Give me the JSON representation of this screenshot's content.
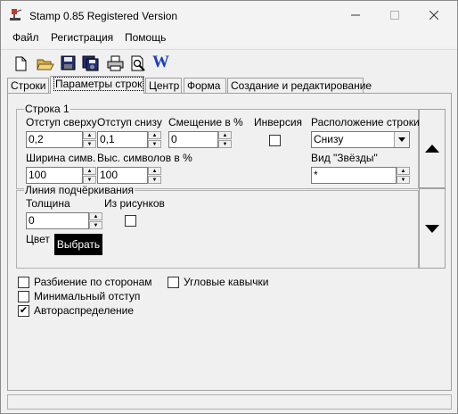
{
  "window": {
    "title": "Stamp 0.85 Registered Version"
  },
  "menu": [
    "Файл",
    "Регистрация",
    "Помощь"
  ],
  "tabs": [
    "Строки",
    "Параметры строк",
    "Центр",
    "Форма",
    "Создание и редактирование"
  ],
  "active_tab": "Параметры строк",
  "row_group": {
    "title": "Строка 1",
    "indent_top_label": "Отступ сверху",
    "indent_top_value": "0,2",
    "indent_bottom_label": "Отступ снизу",
    "indent_bottom_value": "0,1",
    "offset_label": "Смещение в %",
    "offset_value": "0",
    "inversion_label": "Инверсия",
    "inversion_checked": false,
    "position_label": "Расположение строки",
    "position_value": "Снизу",
    "width_label": "Ширина симв.",
    "width_value": "100",
    "height_label": "Выс. символов в %",
    "height_value": "100",
    "stars_label": "Вид \"Звёзды\"",
    "stars_value": "*"
  },
  "underline_group": {
    "title": "Линия подчёркивания",
    "thickness_label": "Толщина",
    "thickness_value": "0",
    "from_pictures_label": "Из рисунков",
    "from_pictures_checked": false,
    "color_label": "Цвет",
    "choose_button": "Выбрать",
    "choose_button_color": "#000000"
  },
  "options": {
    "split_sides_label": "Разбиение по сторонам",
    "split_sides_checked": false,
    "angle_quotes_label": "Угловые кавычки",
    "angle_quotes_checked": false,
    "min_indent_label": "Минимальный отступ",
    "min_indent_checked": false,
    "auto_distribution_label": "Автораспределение",
    "auto_distribution_checked": true
  },
  "icons": [
    "new-file-icon",
    "open-folder-icon",
    "save-icon",
    "save-all-icon",
    "print-icon",
    "print-preview-icon",
    "word-icon",
    "arrow-up-icon",
    "arrow-down-icon"
  ],
  "colors": {
    "word_icon": "#1a3fbf",
    "app_icon": "#c0392b"
  }
}
